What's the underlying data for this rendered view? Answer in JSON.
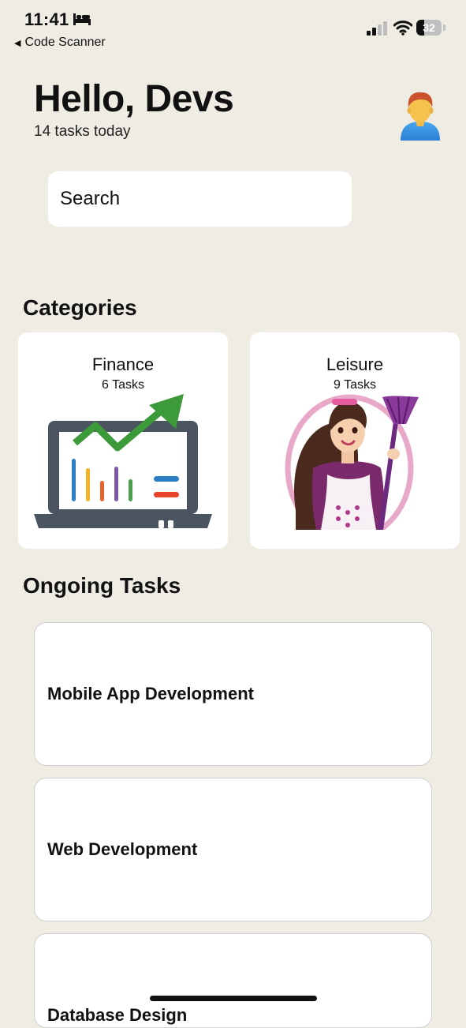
{
  "status_bar": {
    "time": "11:41",
    "back_label": "Code Scanner",
    "battery_level": "32",
    "battery_percent": 32,
    "icons": [
      "bed-icon",
      "signal-icon",
      "wifi-icon",
      "battery-icon"
    ]
  },
  "header": {
    "greeting": "Hello, Devs",
    "subtitle": "14 tasks today",
    "avatar_icon": "person-avatar-icon"
  },
  "search": {
    "placeholder": "Search"
  },
  "categories": {
    "title": "Categories",
    "items": [
      {
        "name": "Finance",
        "count": "6 Tasks",
        "image": "laptop-growth-chart-illustration"
      },
      {
        "name": "Leisure",
        "count": "9 Tasks",
        "image": "woman-with-broom-illustration"
      }
    ]
  },
  "ongoing": {
    "title": "Ongoing Tasks",
    "tasks": [
      {
        "title": "Mobile App Development"
      },
      {
        "title": "Web Development"
      },
      {
        "title": "Database Design"
      }
    ]
  },
  "colors": {
    "background": "#efece3",
    "card": "#ffffff",
    "text": "#111111",
    "chart_green": "#3d9a3a",
    "laptop_gray": "#4a5560"
  }
}
